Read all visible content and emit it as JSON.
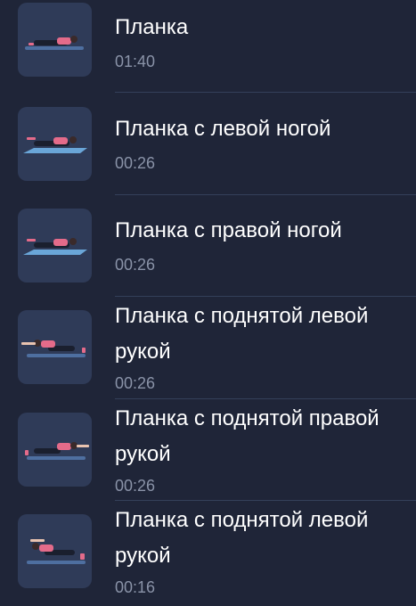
{
  "exercises": [
    {
      "title": "Планка",
      "duration": "01:40"
    },
    {
      "title": "Планка с левой ногой",
      "duration": "00:26"
    },
    {
      "title": "Планка с правой ногой",
      "duration": "00:26"
    },
    {
      "title": "Планка с поднятой левой рукой",
      "duration": "00:26"
    },
    {
      "title": "Планка с поднятой правой рукой",
      "duration": "00:26"
    },
    {
      "title": "Планка с поднятой левой рукой",
      "duration": "00:16"
    }
  ],
  "colors": {
    "background": "#1f2538",
    "thumbnail": "#2f3b58",
    "title": "#ffffff",
    "duration": "#8a93a8",
    "mat": "#6aa6d8",
    "accent": "#e46b8a"
  },
  "icons": [
    "plank-illustration-icon"
  ]
}
